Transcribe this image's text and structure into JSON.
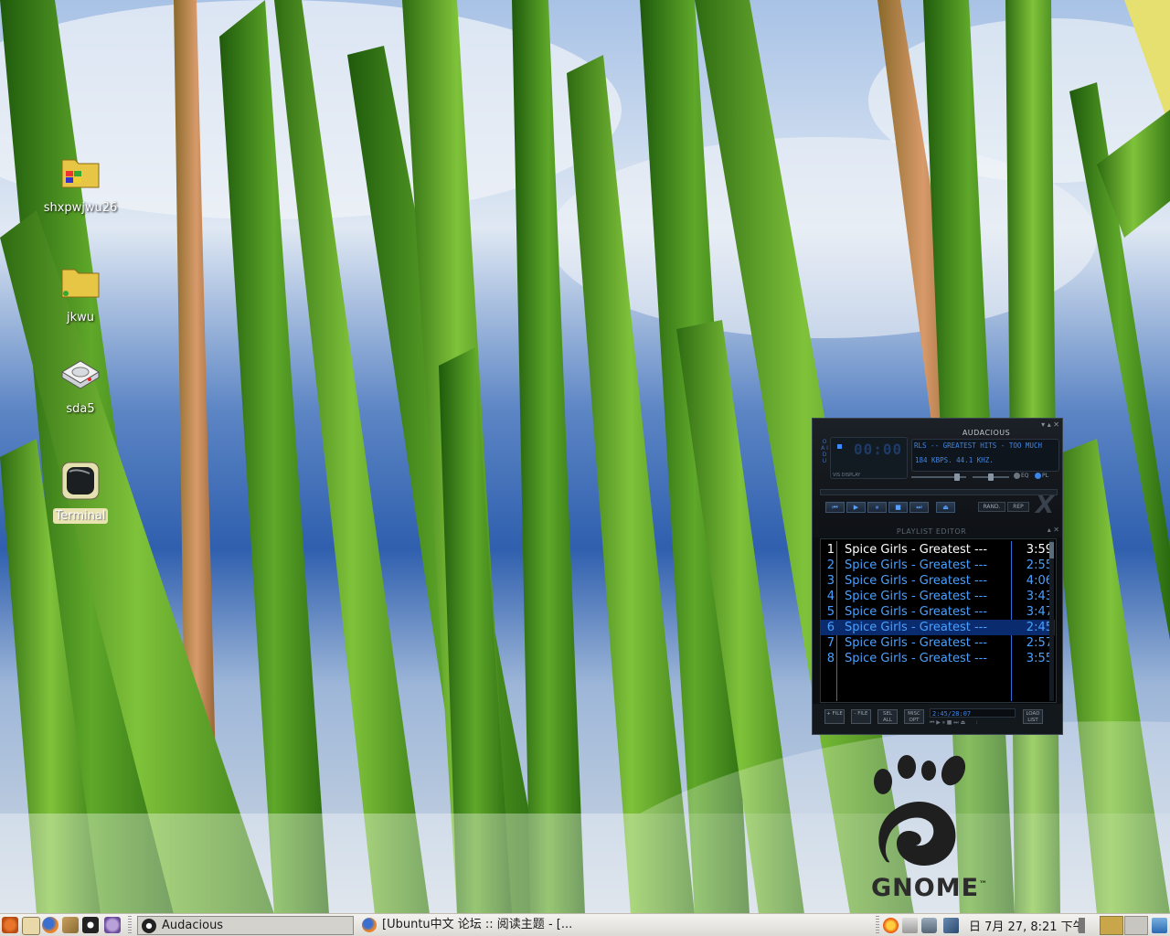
{
  "desktop": {
    "icons": [
      {
        "label": "shxpwjwu26",
        "icon": "windows-folder-icon"
      },
      {
        "label": "jkwu",
        "icon": "folder-icon"
      },
      {
        "label": "sda5",
        "icon": "drive-icon"
      },
      {
        "label": "Terminal",
        "icon": "terminal-icon"
      }
    ],
    "logo_text": "GNOME",
    "logo_tm": "™"
  },
  "audacious": {
    "title": "AUDACIOUS",
    "time": "00:00",
    "side_label": "O A I D U",
    "vis_label": "VIS DISPLAY",
    "marquee": "RLS -- GREATEST HITS - TOO MUCH",
    "bitrate": "184 KBPS. 44.1 KHZ.",
    "toggle_eq": "EQ",
    "toggle_pl": "PL",
    "buttons": [
      "prev",
      "play",
      "pause",
      "stop",
      "next",
      "eject"
    ],
    "rand_label": "RAND.",
    "rep_label": "REP",
    "playlist": {
      "title": "PLAYLIST EDITOR",
      "items": [
        {
          "num": "1",
          "name": "Spice Girls - Greatest ---",
          "duration": "3:59"
        },
        {
          "num": "2",
          "name": "Spice Girls - Greatest ---",
          "duration": "2:55"
        },
        {
          "num": "3",
          "name": "Spice Girls - Greatest ---",
          "duration": "4:06"
        },
        {
          "num": "4",
          "name": "Spice Girls - Greatest ---",
          "duration": "3:43"
        },
        {
          "num": "5",
          "name": "Spice Girls - Greatest ---",
          "duration": "3:47"
        },
        {
          "num": "6",
          "name": "Spice Girls - Greatest ---",
          "duration": "2:45"
        },
        {
          "num": "7",
          "name": "Spice Girls - Greatest ---",
          "duration": "2:57"
        },
        {
          "num": "8",
          "name": "Spice Girls - Greatest ---",
          "duration": "3:55"
        }
      ],
      "current_index": 0,
      "selected_index": 5,
      "footer": {
        "add_file": "+ FILE",
        "remove_file": "- FILE",
        "select_all": "SEL ALL",
        "misc_opt": "MISC OPT",
        "time_info": "2:45/28:07",
        "load_list": "LOAD LIST"
      }
    }
  },
  "taskbar": {
    "tasks": [
      {
        "label": "Audacious",
        "active": true
      },
      {
        "label": "[Ubuntu中文 论坛 :: 阅读主题 - [...",
        "active": false
      }
    ],
    "clock": "日 7月 27, 8:21 下午"
  },
  "colors": {
    "lcd_blue": "#3f86e8",
    "playlist_text": "#4aa0ff",
    "playlist_selected_bg": "#0a2c6e",
    "taskbar_bg": "#e8e6e1"
  }
}
